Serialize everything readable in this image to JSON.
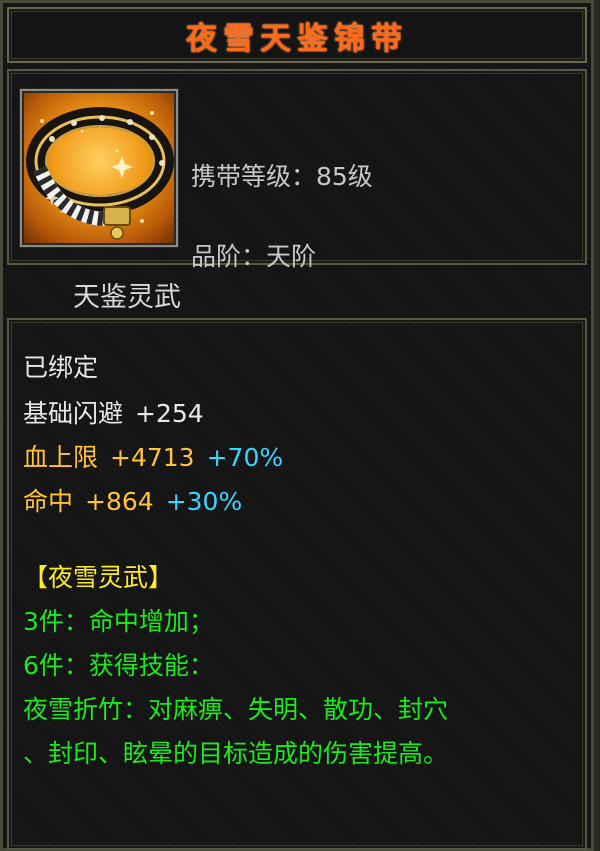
{
  "title": "夜雪天鉴锦带",
  "icon": "ornate-gold-belt-icon",
  "info": {
    "level": "携带等级：85级",
    "grade": "品阶：天阶"
  },
  "series_name": "天鉴灵武",
  "stats": {
    "bound": "已绑定",
    "dodge": {
      "label": "基础闪避",
      "value": "+254"
    },
    "hp": {
      "label": "血上限",
      "value": "+4713",
      "bonus": "+70%"
    },
    "hit": {
      "label": "命中",
      "value": "+864",
      "bonus": "+30%"
    }
  },
  "set": {
    "name": "【夜雪灵武】",
    "bonus3": "3件：命中增加；",
    "bonus6": "6件：获得技能：",
    "skill_line1": "夜雪折竹：对麻痹、失明、散功、封穴",
    "skill_line2": "、封印、眩晕的目标造成的伤害提高。"
  },
  "colors": {
    "title": "#ff6a1a",
    "gold": "#ffc23a",
    "cyan": "#38d6ff",
    "green": "#1ee81e",
    "yellow": "#ffea2a"
  }
}
